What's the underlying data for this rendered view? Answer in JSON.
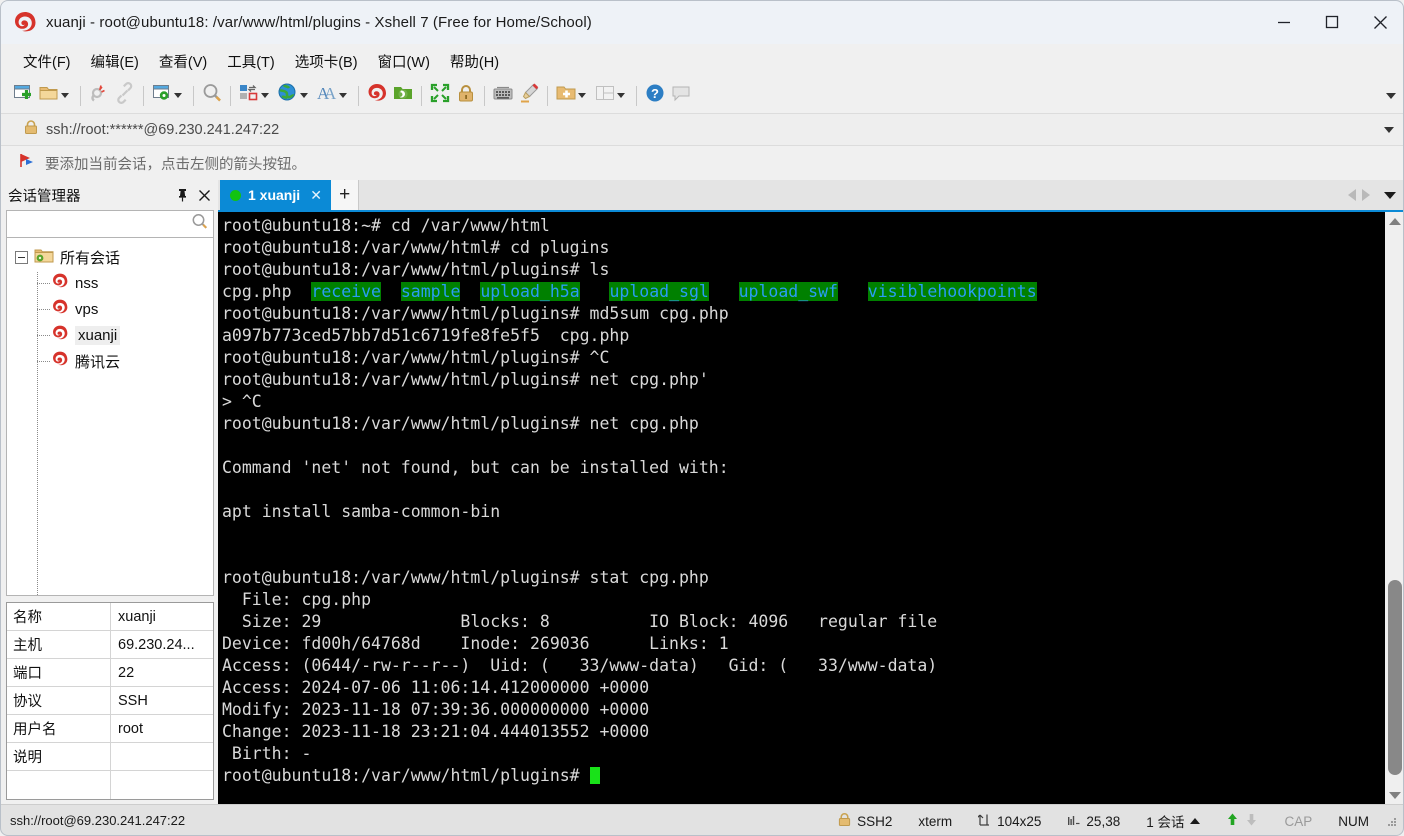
{
  "window": {
    "title": "xuanji - root@ubuntu18: /var/www/html/plugins - Xshell 7 (Free for Home/School)",
    "app_icon": "xshell-spiral-icon",
    "minimize_label": "─",
    "maximize_label": "☐",
    "close_label": "✕"
  },
  "menubar": {
    "items": [
      {
        "label": "文件(F)",
        "name": "menu-file"
      },
      {
        "label": "编辑(E)",
        "name": "menu-edit"
      },
      {
        "label": "查看(V)",
        "name": "menu-view"
      },
      {
        "label": "工具(T)",
        "name": "menu-tools"
      },
      {
        "label": "选项卡(B)",
        "name": "menu-tabs"
      },
      {
        "label": "窗口(W)",
        "name": "menu-window"
      },
      {
        "label": "帮助(H)",
        "name": "menu-help"
      }
    ]
  },
  "toolbar": {
    "icons": [
      "new-session-icon",
      "open-folder-icon",
      "disconnect-icon",
      "link-icon",
      "session-properties-icon",
      "find-icon",
      "transfer-icon",
      "globe-icon",
      "font-icon",
      "xshell-icon",
      "xftp-icon",
      "fullscreen-icon",
      "lock-icon",
      "keyboard-icon",
      "highlight-icon",
      "add-folder-icon",
      "layout-icon",
      "help-icon",
      "comment-icon"
    ],
    "overflow_label": "▾"
  },
  "address": {
    "lock_icon": "lock-icon",
    "value": "ssh://root:******@69.230.241.247:22",
    "placeholder": "ssh://",
    "dropdown_label": "▾"
  },
  "notice": {
    "icon": "red-flag-icon",
    "text": "要添加当前会话，点击左侧的箭头按钮。"
  },
  "session_manager": {
    "title": "会话管理器",
    "pin_label": "⚐",
    "close_label": "✕",
    "search_placeholder": "",
    "search_value": "",
    "search_icon": "search-icon",
    "tree": {
      "root": {
        "label": "所有会话",
        "icon": "folder-sessions-icon",
        "expanded": true
      },
      "children": [
        {
          "label": "nss",
          "icon": "xshell-session-icon",
          "selected": false
        },
        {
          "label": "vps",
          "icon": "xshell-session-icon",
          "selected": false
        },
        {
          "label": "xuanji",
          "icon": "xshell-session-icon",
          "selected": true
        },
        {
          "label": "腾讯云",
          "icon": "xshell-session-icon",
          "selected": false
        }
      ]
    },
    "properties": [
      {
        "key": "名称",
        "value": "xuanji"
      },
      {
        "key": "主机",
        "value": "69.230.24..."
      },
      {
        "key": "端口",
        "value": "22"
      },
      {
        "key": "协议",
        "value": "SSH"
      },
      {
        "key": "用户名",
        "value": "root"
      },
      {
        "key": "说明",
        "value": ""
      },
      {
        "key": "",
        "value": ""
      }
    ]
  },
  "tabs": {
    "items": [
      {
        "index": "1",
        "name": "xuanji",
        "label": "1 xuanji",
        "active": true,
        "status": "connected",
        "close_label": "✕"
      }
    ],
    "new_tab_label": "+",
    "prev_label": "◀",
    "next_label": "▶",
    "list_label": "▾"
  },
  "terminal": {
    "prompt_root": "root@ubuntu18:~#",
    "prompt_html": "root@ubuntu18:/var/www/html#",
    "prompt_plugins": "root@ubuntu18:/var/www/html/plugins#",
    "cursor_color": "#19e219",
    "dir_bg_color": "#008000",
    "dir_fg_color": "#2a9df4",
    "fg_color": "#d9d9d9",
    "bg_color": "#000000",
    "lines": [
      {
        "segs": [
          {
            "t": "root@ubuntu18:~# cd /var/www/html"
          }
        ]
      },
      {
        "segs": [
          {
            "t": "root@ubuntu18:/var/www/html# cd plugins"
          }
        ]
      },
      {
        "segs": [
          {
            "t": "root@ubuntu18:/var/www/html/plugins# ls"
          }
        ]
      },
      {
        "segs": [
          {
            "t": "cpg.php  "
          },
          {
            "t": "receive",
            "c": "dir"
          },
          {
            "t": "  "
          },
          {
            "t": "sample",
            "c": "dir"
          },
          {
            "t": "  "
          },
          {
            "t": "upload_h5a",
            "c": "dir"
          },
          {
            "t": "   "
          },
          {
            "t": "upload_sgl",
            "c": "dir"
          },
          {
            "t": "   "
          },
          {
            "t": "upload_swf",
            "c": "dir"
          },
          {
            "t": "   "
          },
          {
            "t": "visiblehookpoints",
            "c": "dir"
          }
        ]
      },
      {
        "segs": [
          {
            "t": "root@ubuntu18:/var/www/html/plugins# md5sum cpg.php"
          }
        ]
      },
      {
        "segs": [
          {
            "t": "a097b773ced57bb7d51c6719fe8fe5f5  cpg.php"
          }
        ]
      },
      {
        "segs": [
          {
            "t": "root@ubuntu18:/var/www/html/plugins# ^C"
          }
        ]
      },
      {
        "segs": [
          {
            "t": "root@ubuntu18:/var/www/html/plugins# net cpg.php'"
          }
        ]
      },
      {
        "segs": [
          {
            "t": "> ^C"
          }
        ]
      },
      {
        "segs": [
          {
            "t": "root@ubuntu18:/var/www/html/plugins# net cpg.php"
          }
        ]
      },
      {
        "segs": [
          {
            "t": ""
          }
        ]
      },
      {
        "segs": [
          {
            "t": "Command 'net' not found, but can be installed with:"
          }
        ]
      },
      {
        "segs": [
          {
            "t": ""
          }
        ]
      },
      {
        "segs": [
          {
            "t": "apt install samba-common-bin"
          }
        ]
      },
      {
        "segs": [
          {
            "t": ""
          }
        ]
      },
      {
        "segs": [
          {
            "t": ""
          }
        ]
      },
      {
        "segs": [
          {
            "t": "root@ubuntu18:/var/www/html/plugins# stat cpg.php"
          }
        ]
      },
      {
        "segs": [
          {
            "t": "  File: cpg.php"
          }
        ]
      },
      {
        "segs": [
          {
            "t": "  Size: 29              Blocks: 8          IO Block: 4096   regular file"
          }
        ]
      },
      {
        "segs": [
          {
            "t": "Device: fd00h/64768d    Inode: 269036      Links: 1"
          }
        ]
      },
      {
        "segs": [
          {
            "t": "Access: (0644/-rw-r--r--)  Uid: (   33/www-data)   Gid: (   33/www-data)"
          }
        ]
      },
      {
        "segs": [
          {
            "t": "Access: 2024-07-06 11:06:14.412000000 +0000"
          }
        ]
      },
      {
        "segs": [
          {
            "t": "Modify: 2023-11-18 07:39:36.000000000 +0000"
          }
        ]
      },
      {
        "segs": [
          {
            "t": "Change: 2023-11-18 23:21:04.444013552 +0000"
          }
        ]
      },
      {
        "segs": [
          {
            "t": " Birth: -"
          }
        ]
      },
      {
        "segs": [
          {
            "t": "root@ubuntu18:/var/www/html/plugins# "
          },
          {
            "t": " ",
            "c": "cursor"
          }
        ]
      }
    ]
  },
  "statusbar": {
    "connection": "ssh://root@69.230.241.247:22",
    "protocol": "SSH2",
    "protocol_icon": "lock-icon",
    "terminal_type": "xterm",
    "size_icon": "resize-icon",
    "size": "104x25",
    "cursor_icon": "cursor-pos-icon",
    "cursor_pos": "25,38",
    "sessions": "1 会话",
    "sessions_caret": "▴",
    "upload_icon": "arrow-up-icon",
    "download_icon": "arrow-down-icon",
    "caps": "CAP",
    "num": "NUM",
    "grip_icon": "resize-grip-icon"
  }
}
